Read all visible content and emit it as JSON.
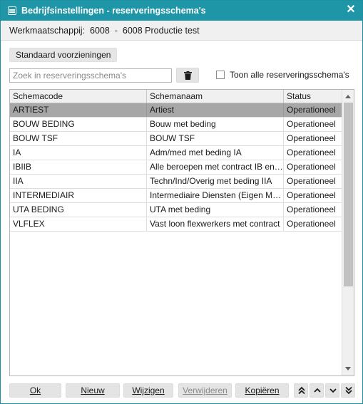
{
  "window": {
    "title": "Bedrijfsinstellingen - reserveringsschema's",
    "close_glyph": "✕",
    "icon": "table-window-icon"
  },
  "company": {
    "label": "Werkmaatschappij:",
    "code": "6008",
    "separator": "-",
    "name": "6008 Productie test"
  },
  "toolbar": {
    "standard_button": "Standaard voorzieningen",
    "search_placeholder": "Zoek in reserveringsschema's",
    "search_value": "",
    "clear_icon": "trash-icon",
    "show_all_label": "Toon alle reserveringsschema's",
    "show_all_checked": false
  },
  "table": {
    "columns": [
      "Schemacode",
      "Schemanaam",
      "Status"
    ],
    "rows": [
      {
        "code": "ARTIEST",
        "name": "Artiest",
        "status": "Operationeel",
        "selected": true
      },
      {
        "code": "BOUW BEDING",
        "name": "Bouw met beding",
        "status": "Operationeel",
        "selected": false
      },
      {
        "code": "BOUW TSF",
        "name": "BOUW TSF",
        "status": "Operationeel",
        "selected": false
      },
      {
        "code": "IA",
        "name": "Adm/med met beding IA",
        "status": "Operationeel",
        "selected": false
      },
      {
        "code": "IBIIB",
        "name": "Alle beroepen met contract IB en IIB",
        "status": "Operationeel",
        "selected": false
      },
      {
        "code": "IIA",
        "name": "Techn/Ind/Overig met beding IIA",
        "status": "Operationeel",
        "selected": false
      },
      {
        "code": "INTERMEDIAIR",
        "name": "Intermediaire Diensten (Eigen Medewerkers)",
        "status": "Operationeel",
        "selected": false
      },
      {
        "code": "UTA BEDING",
        "name": "UTA met beding",
        "status": "Operationeel",
        "selected": false
      },
      {
        "code": "VLFLEX",
        "name": "Vast loon flexwerkers met contract",
        "status": "Operationeel",
        "selected": false
      }
    ]
  },
  "buttons": {
    "ok": "Ok",
    "new": "Nieuw",
    "edit": "Wijzigen",
    "delete": "Verwijderen",
    "copy": "Kopiëren"
  },
  "nav_icons": [
    "double-chevron-up-icon",
    "chevron-up-icon",
    "chevron-down-icon",
    "double-chevron-down-icon"
  ],
  "colors": {
    "titlebar": "#1e96a8",
    "selected_row": "#a7a7a7"
  }
}
